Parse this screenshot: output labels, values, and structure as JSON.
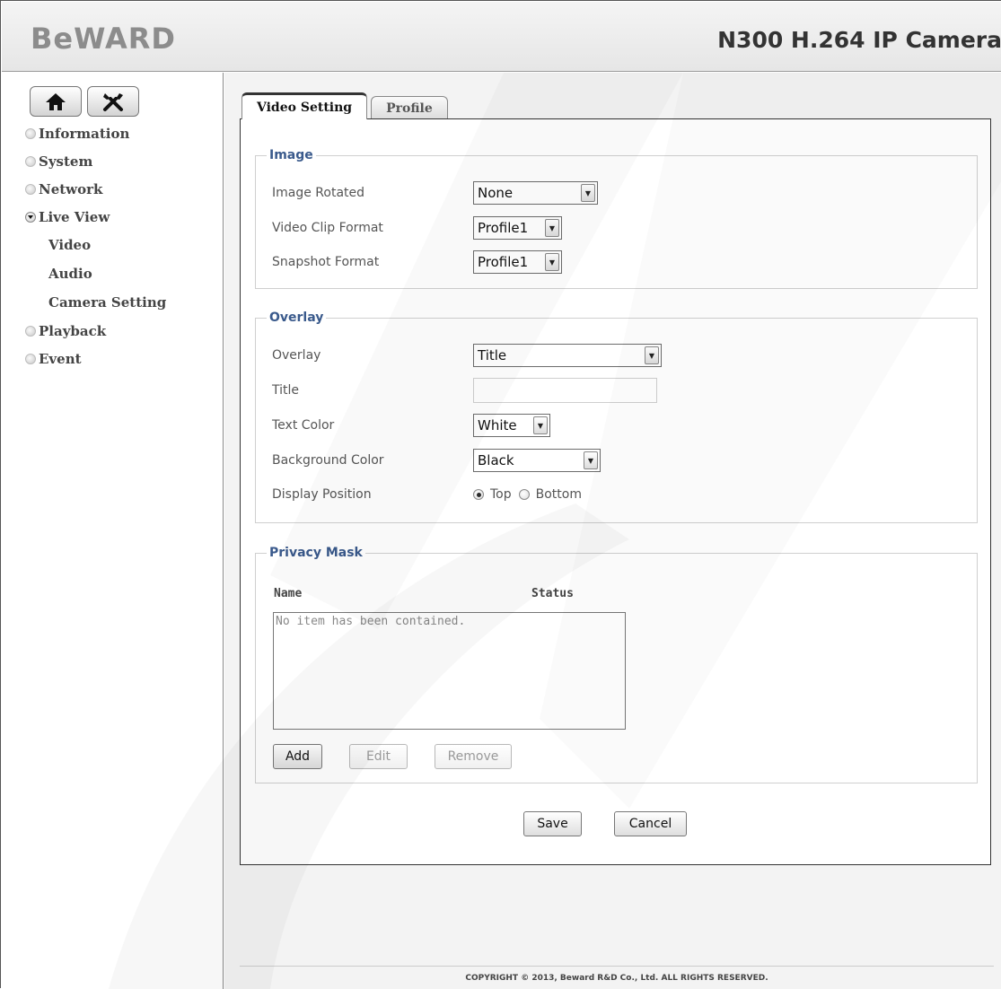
{
  "header": {
    "logo": "BeWARD",
    "product": "N300 H.264 IP Camera"
  },
  "sidebar": {
    "icon_buttons": [
      "home-icon",
      "tools-icon"
    ],
    "items": [
      {
        "label": "Information"
      },
      {
        "label": "System"
      },
      {
        "label": "Network"
      },
      {
        "label": "Live View",
        "expanded": true,
        "children": [
          "Video",
          "Audio",
          "Camera Setting"
        ]
      },
      {
        "label": "Playback"
      },
      {
        "label": "Event"
      }
    ]
  },
  "tabs": [
    {
      "label": "Video Setting",
      "active": true
    },
    {
      "label": "Profile",
      "active": false
    }
  ],
  "image": {
    "legend": "Image",
    "rotated_label": "Image Rotated",
    "rotated_value": "None",
    "clip_label": "Video Clip Format",
    "clip_value": "Profile1",
    "snapshot_label": "Snapshot Format",
    "snapshot_value": "Profile1"
  },
  "overlay": {
    "legend": "Overlay",
    "overlay_label": "Overlay",
    "overlay_value": "Title",
    "title_label": "Title",
    "title_value": "",
    "text_color_label": "Text Color",
    "text_color_value": "White",
    "bg_color_label": "Background Color",
    "bg_color_value": "Black",
    "position_label": "Display Position",
    "position_options": [
      "Top",
      "Bottom"
    ],
    "position_selected": "Top"
  },
  "privacy": {
    "legend": "Privacy Mask",
    "col_name": "Name",
    "col_status": "Status",
    "empty_text": "No item has been contained.",
    "add_label": "Add",
    "edit_label": "Edit",
    "remove_label": "Remove"
  },
  "actions": {
    "save_label": "Save",
    "cancel_label": "Cancel"
  },
  "footer": "COPYRIGHT © 2013, Beward R&D Co., Ltd. ALL RIGHTS RESERVED.",
  "colors": {
    "legend": "#3a5a8c",
    "panel_bg": "#f3f3f3"
  }
}
